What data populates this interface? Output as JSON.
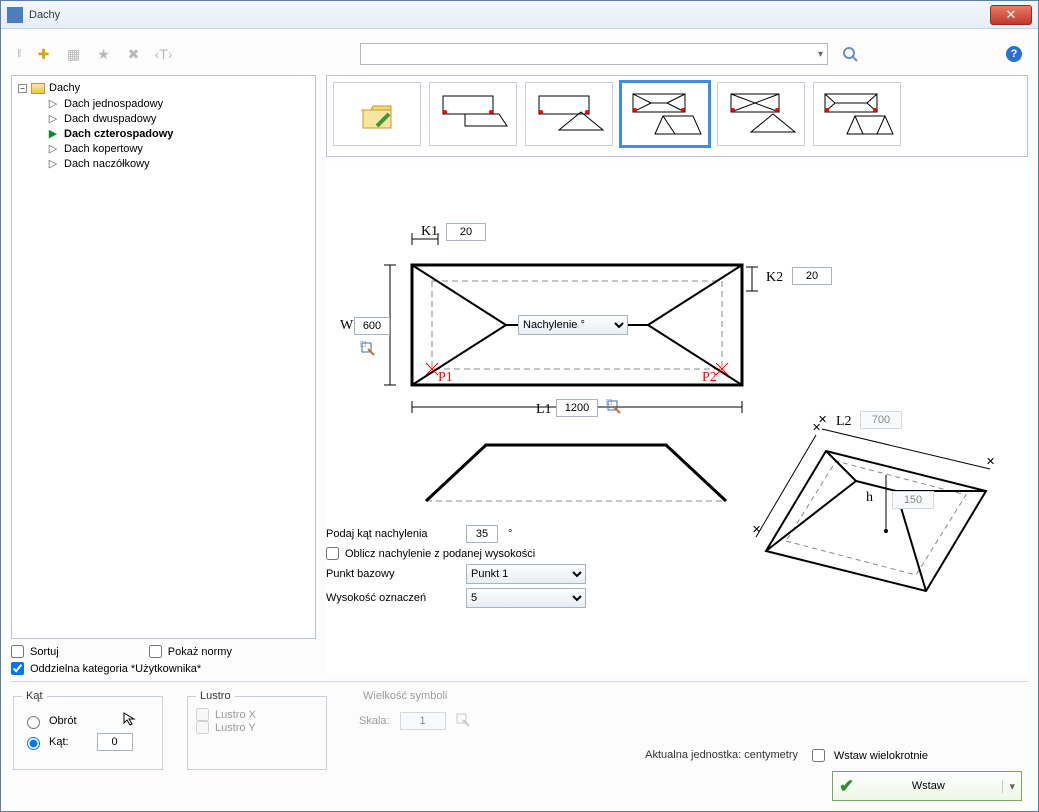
{
  "window": {
    "title": "Dachy"
  },
  "toolbar": {
    "icons": [
      "plus",
      "grid",
      "star",
      "close",
      "text"
    ]
  },
  "tree": {
    "root": "Dachy",
    "items": [
      {
        "label": "Dach jednospadowy",
        "selected": false
      },
      {
        "label": "Dach dwuspadowy",
        "selected": false
      },
      {
        "label": "Dach czterospadowy",
        "selected": true
      },
      {
        "label": "Dach kopertowy",
        "selected": false
      },
      {
        "label": "Dach naczółkowy",
        "selected": false
      }
    ]
  },
  "left_checks": {
    "sort": "Sortuj",
    "show_norms": "Pokaż normy",
    "own_cat": "Oddzielna kategoria *Użytkownika*",
    "own_cat_checked": true
  },
  "diagram": {
    "k1_label": "K1",
    "k1_value": "20",
    "k2_label": "K2",
    "k2_value": "20",
    "w1_label": "W1",
    "w1_value": "600",
    "l1_label": "L1",
    "l1_value": "1200",
    "l2_label": "L2",
    "l2_value": "700",
    "h_label": "h",
    "h_value": "150",
    "p1": "P1",
    "p2": "P2",
    "slope_select": "Nachylenie °"
  },
  "config": {
    "angle_label": "Podaj kąt nachylenia",
    "angle_value": "35",
    "angle_suffix": "°",
    "calc_from_height": "Oblicz nachylenie z podanej wysokości",
    "base_point_label": "Punkt bazowy",
    "base_point_value": "Punkt 1",
    "marks_height_label": "Wysokość oznaczeń",
    "marks_height_value": "5"
  },
  "bottom": {
    "angle_group": "Kąt",
    "rotate": "Obrót",
    "angle": "Kąt:",
    "angle_value": "0",
    "mirror_group": "Lustro",
    "mirror_x": "Lustro X",
    "mirror_y": "Lustro Y",
    "symbol_group": "Wielkość symboli",
    "scale_label": "Skala:",
    "scale_value": "1",
    "unit_label": "Aktualna jednostka: centymetry",
    "insert_multi": "Wstaw wielokrotnie",
    "insert": "Wstaw"
  }
}
